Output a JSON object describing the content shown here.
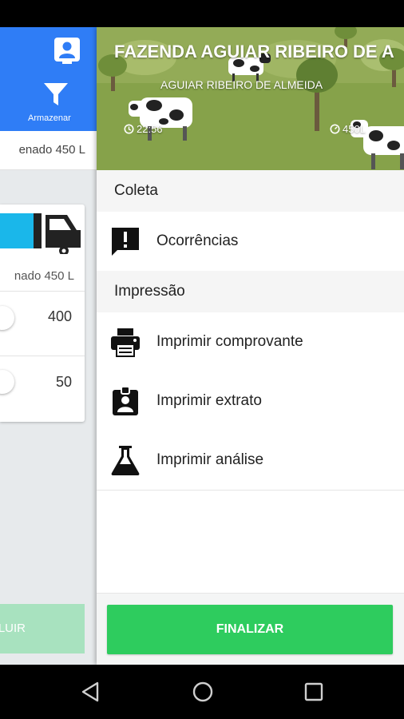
{
  "left_panel": {
    "filter_label": "Armazenar",
    "stored_text": "enado 450 L",
    "card": {
      "stored_text": "nado 450 L",
      "quantities": [
        "400",
        "50"
      ]
    },
    "include_button": "LUIR"
  },
  "drawer": {
    "banner": {
      "farm_name": "FAZENDA AGUIAR RIBEIRO DE A",
      "owner": "AGUIAR RIBEIRO DE ALMEIDA",
      "time": "22:56",
      "volume": "450L"
    },
    "sections": [
      {
        "title": "Coleta",
        "items": [
          {
            "label": "Ocorrências",
            "icon": "feedback-icon"
          }
        ]
      },
      {
        "title": "Impressão",
        "items": [
          {
            "label": "Imprimir comprovante",
            "icon": "printer-icon"
          },
          {
            "label": "Imprimir extrato",
            "icon": "badge-icon"
          },
          {
            "label": "Imprimir análise",
            "icon": "flask-icon"
          }
        ]
      }
    ],
    "finish_button": "FINALIZAR"
  },
  "colors": {
    "primary_blue": "#2f7df6",
    "finish_green": "#2ecc5e",
    "include_green_disabled": "#a8e2bf",
    "truck_tank": "#1ab7ea"
  }
}
